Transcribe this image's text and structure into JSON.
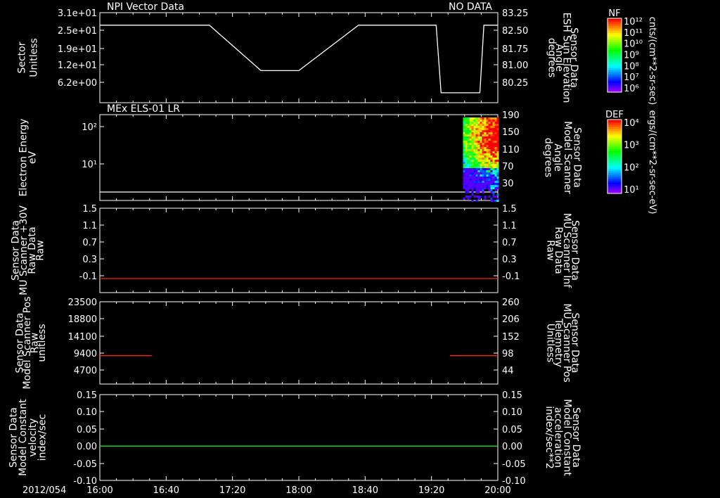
{
  "page": {
    "date_label": "2012/054"
  },
  "time_axis": {
    "ticks": [
      "16:00",
      "16:40",
      "17:20",
      "18:00",
      "18:40",
      "19:20",
      "20:00"
    ],
    "range_hours": [
      16.0,
      20.0
    ]
  },
  "colorbars": [
    {
      "tag": "NF",
      "units": "cnts/(cm**2-sr-sec)",
      "ticks": [
        "10¹²",
        "10¹¹",
        "10¹⁰",
        "10⁹",
        "10⁸",
        "10⁷",
        "10⁶"
      ]
    },
    {
      "tag": "DEF",
      "units": "ergs/(cm**2-sr-sec-eV)",
      "ticks": [
        "10⁴",
        "10³",
        "10²",
        "10¹"
      ]
    }
  ],
  "colors": {
    "white": "#ffffff",
    "red": "#ff2020",
    "green": "#20e020"
  },
  "chart_data": [
    {
      "type": "line",
      "title": "NPI Vector Data",
      "status": "NO DATA",
      "ylabel": [
        "Sector",
        "Unitless"
      ],
      "ylabel_right": [
        "Sensor Data",
        "ESH Sun Elevation",
        "Angle",
        "degrees"
      ],
      "yticks_left": [
        "3.1e+01",
        "2.5e+01",
        "1.9e+01",
        "1.2e+01",
        "6.2e+00"
      ],
      "yticks_right": [
        "83.25",
        "82.50",
        "81.75",
        "81.00",
        "80.25"
      ],
      "ylim": [
        79.8,
        83.25
      ],
      "series": [
        {
          "color": "white",
          "x": [
            16.0,
            17.1,
            17.62,
            18.0,
            18.6,
            19.38,
            19.43,
            19.82,
            19.86,
            20.0
          ],
          "y": [
            82.77,
            82.77,
            81.03,
            81.03,
            82.77,
            82.77,
            80.18,
            80.18,
            82.77,
            82.77
          ]
        }
      ]
    },
    {
      "type": "heatmap",
      "title": "MEx ELS-01 LR",
      "ylabel": [
        "Electron Energy",
        "eV"
      ],
      "ylabel_right": [
        "Sensor Data",
        "Model Scanner",
        "Angle",
        "degrees"
      ],
      "yticks_left": [
        "10²",
        "10¹"
      ],
      "yticks_right": [
        "190",
        "150",
        "110",
        "70",
        "30"
      ],
      "x_start": 19.65,
      "note": "spectrogram data present 19:39–20:00; horizontal reference line near bottom"
    },
    {
      "type": "line",
      "ylabel": [
        "Sensor Data",
        "MU Scanner +30V",
        "Raw Data",
        "Raw"
      ],
      "ylabel_right": [
        "Sensor Data",
        "MU Scanner Inf",
        "Raw Data",
        "Raw"
      ],
      "yticks_left": [
        "1.5",
        "1.1",
        "0.7",
        "0.3",
        "-0.1"
      ],
      "yticks_right": [
        "1.5",
        "1.1",
        "0.7",
        "0.3",
        "-0.1"
      ],
      "ylim": [
        -0.3,
        1.5
      ],
      "series": [
        {
          "color": "red",
          "x": [
            16.0,
            20.0
          ],
          "y": [
            0.0,
            0.0
          ]
        }
      ]
    },
    {
      "type": "line",
      "ylabel": [
        "Sensor Data",
        "Model Scanner Pos",
        "Raw",
        "unitless"
      ],
      "ylabel_right": [
        "Sensor Data",
        "MU Scanner Pos",
        "Telemetry",
        "Unitless"
      ],
      "yticks_left": [
        "23500",
        "18800",
        "14100",
        "9400",
        "4700"
      ],
      "yticks_right": [
        "260",
        "206",
        "152",
        "98",
        "44"
      ],
      "ylim": [
        0,
        23500
      ],
      "series": [
        {
          "color": "red",
          "x": [
            16.0,
            16.52
          ],
          "y": [
            8100,
            8100
          ]
        },
        {
          "color": "red",
          "x": [
            19.52,
            20.0
          ],
          "y": [
            8100,
            8100
          ]
        }
      ]
    },
    {
      "type": "line",
      "ylabel": [
        "Sensor Data",
        "Model Constant",
        "velocity",
        "index/sec"
      ],
      "ylabel_right": [
        "Sensor Data",
        "Model Constant",
        "acceleration",
        "index/sec**2"
      ],
      "yticks_left": [
        "0.15",
        "0.10",
        "0.05",
        "0.00",
        "-0.05",
        "-0.10"
      ],
      "yticks_right": [
        "0.15",
        "0.10",
        "0.05",
        "0.00",
        "-0.05",
        "-0.10"
      ],
      "ylim": [
        -0.1,
        0.15
      ],
      "series": [
        {
          "color": "green",
          "x": [
            16.0,
            20.0
          ],
          "y": [
            0.0,
            0.0
          ]
        }
      ]
    }
  ]
}
